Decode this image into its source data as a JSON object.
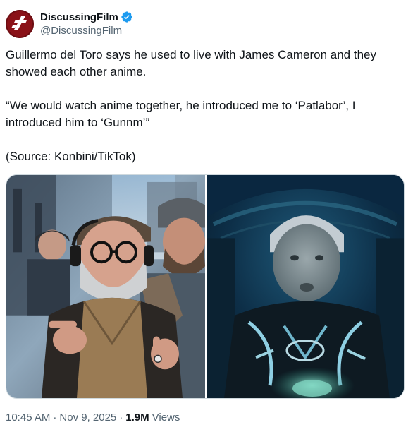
{
  "author": {
    "display_name": "DiscussingFilm",
    "handle": "@DiscussingFilm",
    "avatar_icon": "discussingfilm-logo",
    "verified_icon": "verified-badge-icon",
    "verified_color": "#1d9bf0",
    "brand_color": "#8a1218"
  },
  "tweet": {
    "paragraphs": [
      "Guillermo del Toro says he used to live with James Cameron and they showed each other anime.",
      "“We would watch anime together, he introduced me to ‘Patlabor’, I introduced him to ‘Gunnm’”",
      "(Source: Konbini/TikTok)"
    ]
  },
  "media": {
    "left_photo": "photo of Guillermo del Toro pointing, wearing headphones and a cap, with a bearded man behind him",
    "right_photo": "photo of James Cameron looking into the camera under blue-green lighting"
  },
  "meta": {
    "time": "10:45 AM",
    "separator": "·",
    "date": "Nov 9, 2025",
    "views_count": "1.9M",
    "views_label": "Views"
  }
}
